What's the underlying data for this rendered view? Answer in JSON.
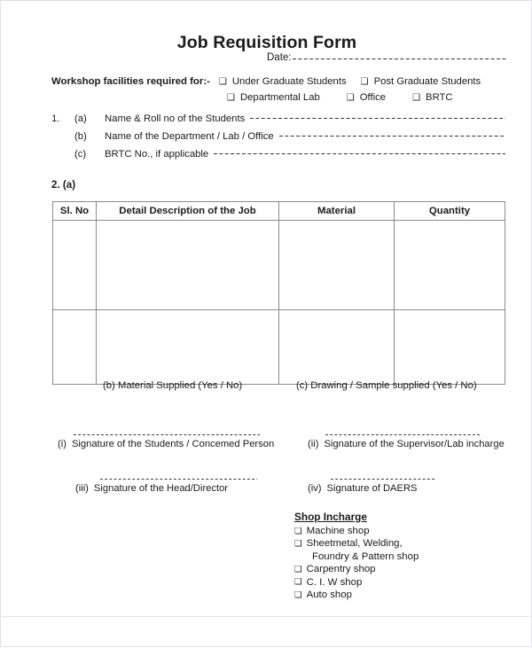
{
  "document": {
    "title": "Job Requisition Form",
    "date_label": "Date:",
    "footer_divider": true
  },
  "facilities": {
    "label": "Workshop facilities required for:-",
    "checkbox_glyph": "❑",
    "row1": [
      {
        "label": "Under Graduate Students"
      },
      {
        "label": "Post Graduate Students"
      }
    ],
    "row2": [
      {
        "label": "Departmental Lab"
      },
      {
        "label": "Office"
      },
      {
        "label": "BRTC"
      }
    ]
  },
  "section1": {
    "number": "1.",
    "items": [
      {
        "marker": "(a)",
        "text": "Name & Roll no of the Students"
      },
      {
        "marker": "(b)",
        "text": "Name of the Department / Lab / Office"
      },
      {
        "marker": "(c)",
        "text": "BRTC No., if applicable"
      }
    ]
  },
  "section2": {
    "label": "2. (a)",
    "table": {
      "columns": [
        "Sl. No",
        "Detail Description of the Job",
        "Material",
        "Quantity"
      ],
      "rows": [
        [
          "",
          "",
          "",
          ""
        ],
        [
          "",
          "",
          "",
          ""
        ]
      ]
    },
    "sub_items": {
      "b": "(b)  Material Supplied (Yes / No)",
      "c": "(c)  Drawing / Sample supplied (Yes / No)"
    }
  },
  "signatures": [
    {
      "marker": "(i)",
      "text": "Signature of the Students / Concemed Person"
    },
    {
      "marker": "(ii)",
      "text": "Signature of the Supervisor/Lab incharge"
    },
    {
      "marker": "(iii)",
      "text": "Signature of the Head/Director"
    },
    {
      "marker": "(iv)",
      "text": "Signature of DAERS"
    }
  ],
  "shop_incharge": {
    "title": "Shop Incharge",
    "items": [
      {
        "label": "Machine shop",
        "continuation": ""
      },
      {
        "label": "Sheetmetal, Welding,",
        "continuation": "Foundry & Pattern shop"
      },
      {
        "label": "Carpentry shop",
        "continuation": ""
      },
      {
        "label": "C. I. W shop",
        "continuation": ""
      },
      {
        "label": "Auto shop",
        "continuation": ""
      }
    ]
  }
}
